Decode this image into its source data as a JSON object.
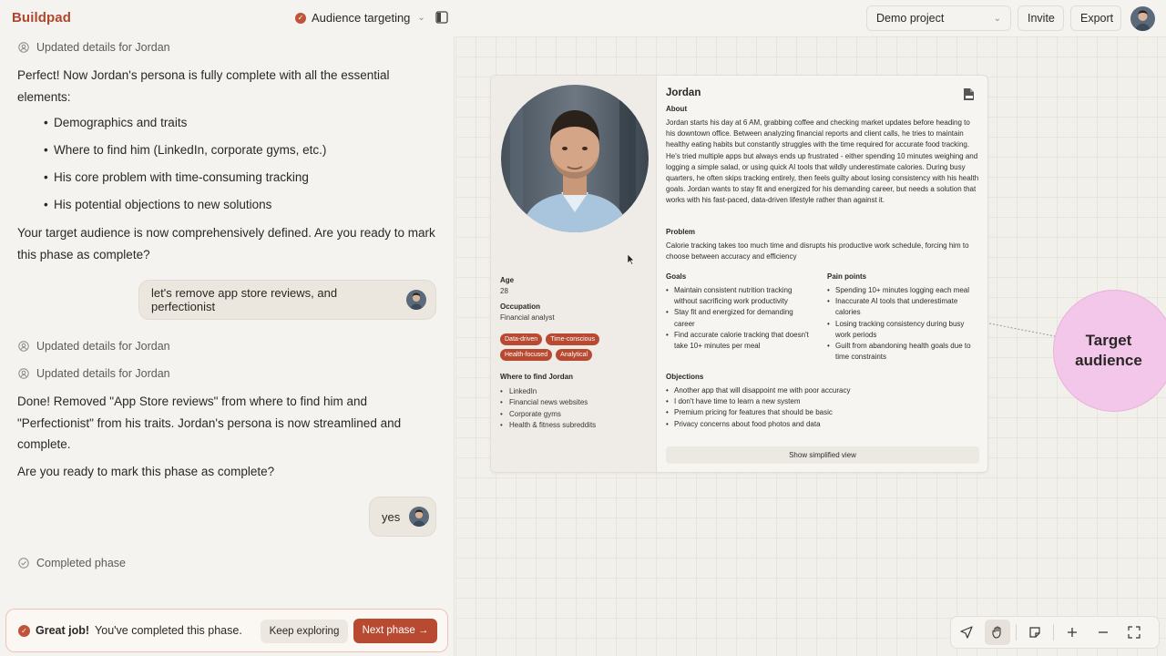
{
  "app": {
    "brand": "Buildpad"
  },
  "header": {
    "phase": "Audience targeting",
    "project": "Demo project",
    "invite": "Invite",
    "export": "Export"
  },
  "chat": {
    "status1": "Updated details for Jordan",
    "para1": "Perfect! Now Jordan's persona is fully complete with all the essential elements:",
    "bullets": [
      "Demographics and traits",
      "Where to find him (LinkedIn, corporate gyms, etc.)",
      "His core problem with time-consuming tracking",
      "His potential objections to new solutions"
    ],
    "para2": "Your target audience is now comprehensively defined. Are you ready to mark this phase as complete?",
    "user_msg1": "let's remove app store reviews, and perfectionist",
    "status2": "Updated details for Jordan",
    "status3": "Updated details for Jordan",
    "para3": "Done! Removed \"App Store reviews\" from where to find him and \"Perfectionist\" from his traits. Jordan's persona is now streamlined and complete.",
    "para4": "Are you ready to mark this phase as complete?",
    "user_msg2": "yes",
    "status4": "Completed phase"
  },
  "footer": {
    "great": "Great job!",
    "message": "You've completed this phase.",
    "keep": "Keep exploring",
    "next": "Next phase →"
  },
  "persona": {
    "name": "Jordan",
    "about_label": "About",
    "about": "Jordan starts his day at 6 AM, grabbing coffee and checking market updates before heading to his downtown office. Between analyzing financial reports and client calls, he tries to maintain healthy eating habits but constantly struggles with the time required for accurate food tracking. He's tried multiple apps but always ends up frustrated - either spending 10 minutes weighing and logging a simple salad, or using quick AI tools that wildly underestimate calories. During busy quarters, he often skips tracking entirely, then feels guilty about losing consistency with his health goals. Jordan wants to stay fit and energized for his demanding career, but needs a solution that works with his fast-paced, data-driven lifestyle rather than against it.",
    "problem_label": "Problem",
    "problem": "Calorie tracking takes too much time and disrupts his productive work schedule, forcing him to choose between accuracy and efficiency",
    "goals_label": "Goals",
    "goals": [
      "Maintain consistent nutrition tracking without sacrificing work productivity",
      "Stay fit and energized for demanding career",
      "Find accurate calorie tracking that doesn't take 10+ minutes per meal"
    ],
    "pain_label": "Pain points",
    "pains": [
      "Spending 10+ minutes logging each meal",
      "Inaccurate AI tools that underestimate calories",
      "Losing tracking consistency during busy work periods",
      "Guilt from abandoning health goals due to time constraints"
    ],
    "objections_label": "Objections",
    "objections": [
      "Another app that will disappoint me with poor accuracy",
      "I don't have time to learn a new system",
      "Premium pricing for features that should be basic",
      "Privacy concerns about food photos and data"
    ],
    "simplified": "Show simplified view",
    "age_label": "Age",
    "age": "28",
    "occupation_label": "Occupation",
    "occupation": "Financial analyst",
    "tags": [
      "Data-driven",
      "Time-conscious",
      "Health-focused",
      "Analytical"
    ],
    "where_label": "Where to find Jordan",
    "where": [
      "LinkedIn",
      "Financial news websites",
      "Corporate gyms",
      "Health & fitness subreddits"
    ]
  },
  "canvas": {
    "node_label": "Target audience"
  },
  "colors": {
    "accent": "#b94a32",
    "node": "#f2c7ea"
  },
  "icons": [
    "person-icon",
    "check-icon",
    "pdf-icon",
    "navigate-icon",
    "hand-icon",
    "note-icon",
    "plus-icon",
    "minus-icon",
    "fullscreen-icon"
  ]
}
